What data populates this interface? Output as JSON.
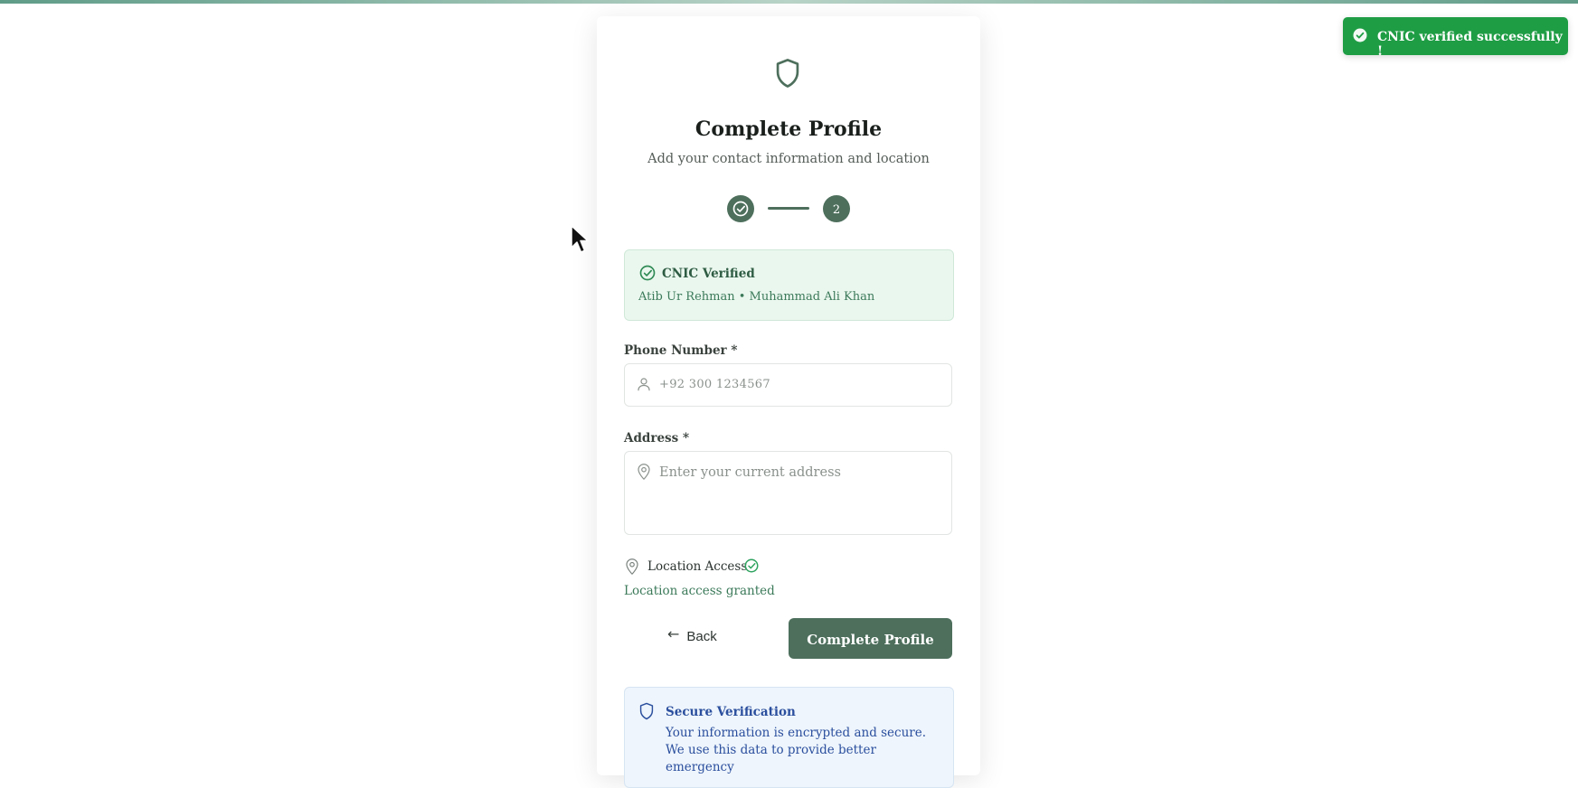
{
  "toast": {
    "message": "CNIC verified successfully !",
    "icon": "check-circle-icon",
    "color": "#1f9d45"
  },
  "header": {
    "icon": "shield-icon",
    "title": "Complete Profile",
    "subtitle": "Add your contact information and location"
  },
  "stepper": {
    "step1_icon": "check-circle-icon",
    "step2_label": "2",
    "color": "#4d6f5c"
  },
  "cnic": {
    "icon": "check-circle-icon",
    "title": "CNIC Verified",
    "names": "Atib Ur Rehman • Muhammad Ali Khan"
  },
  "phone": {
    "label": "Phone Number *",
    "icon": "user-icon",
    "placeholder": "+92 300 1234567",
    "value": ""
  },
  "address": {
    "label": "Address *",
    "icon": "map-pin-icon",
    "placeholder": "Enter your current address",
    "value": ""
  },
  "location": {
    "icon": "map-pin-icon",
    "label": "Location Access",
    "status_icon": "check-circle-icon",
    "status": "Location access granted"
  },
  "actions": {
    "back_icon": "arrow-left-icon",
    "back_label": "Back",
    "submit_label": "Complete Profile"
  },
  "secure": {
    "icon": "shield-icon",
    "title": "Secure Verification",
    "text": "Your information is encrypted and secure. We use this data to provide better emergency"
  },
  "colors": {
    "primary": "#4d6f5c",
    "success_bg": "#eaf7ee",
    "info_bg": "#eef5fc",
    "info_text": "#2b4f9e"
  }
}
